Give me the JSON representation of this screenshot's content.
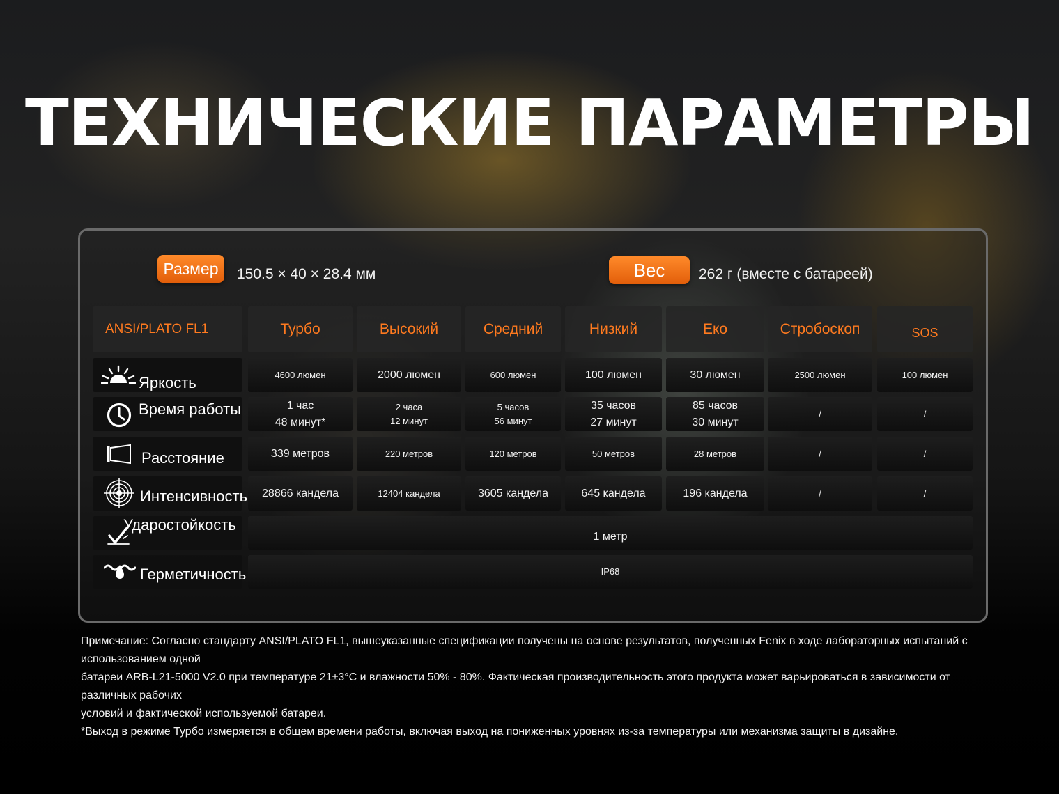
{
  "title": "ТЕХНИЧЕСКИЕ ПАРАМЕТРЫ",
  "specs": {
    "size_label": "Размер",
    "size_value": "150.5 × 40 × 28.4 мм",
    "weight_label": "Вес",
    "weight_value": "262 г (вместе с батареей)"
  },
  "table": {
    "corner": "ANSI/PLATO FL1",
    "modes": [
      "Турбо",
      "Высокий",
      "Средний",
      "Низкий",
      "Еко",
      "Стробоскоп",
      "SOS"
    ],
    "rows": [
      {
        "label": "Яркость",
        "icon": "brightness-icon",
        "values": [
          "4600 люмен",
          "2000 люмен",
          "600 люмен",
          "100 люмен",
          "30 люмен",
          "2500 люмен",
          "100 люмен"
        ]
      },
      {
        "label": "Время работы",
        "icon": "clock-icon",
        "values": [
          [
            "1 час",
            "48 минут*"
          ],
          [
            "2 часа",
            "12 минут"
          ],
          [
            "5 часов",
            "56 минут"
          ],
          [
            "35 часов",
            "27 минут"
          ],
          [
            "85 часов",
            "30 минут"
          ],
          [
            "/"
          ],
          [
            "/"
          ]
        ]
      },
      {
        "label": "Расстояние",
        "icon": "beam-distance-icon",
        "values": [
          "339 метров",
          "220 метров",
          "120 метров",
          "50 метров",
          "28 метров",
          "/",
          "/"
        ]
      },
      {
        "label": "Интенсивность",
        "icon": "target-icon",
        "values": [
          "28866 кандела",
          "12404 кандела",
          "3605 кандела",
          "645 кандела",
          "196 кандела",
          "/",
          "/"
        ]
      }
    ],
    "impact": {
      "label": "Ударостойкость",
      "icon": "impact-resistance-icon",
      "value": "1 метр"
    },
    "waterproof": {
      "label": "Герметичность",
      "icon": "waterproof-icon",
      "value": "IP68"
    }
  },
  "footnote": [
    "Примечание: Согласно стандарту ANSI/PLATO FL1, вышеуказанные спецификации получены на основе результатов, полученных Fenix в ходе лабораторных испытаний с использованием одной",
    "батареи ARB-L21-5000 V2.0 при температуре 21±3°C и влажности 50% - 80%. Фактическая производительность этого продукта может варьироваться в зависимости от различных рабочих",
    "условий и фактической используемой батареи.",
    "*Выход в режиме Турбо измеряется в общем времени работы, включая выход на пониженных уровнях из-за температуры или механизма защиты в дизайне."
  ],
  "colors": {
    "accent": "#ff7a1f",
    "panel_border": "#6a6a6a",
    "cell_bg": "#161616"
  }
}
